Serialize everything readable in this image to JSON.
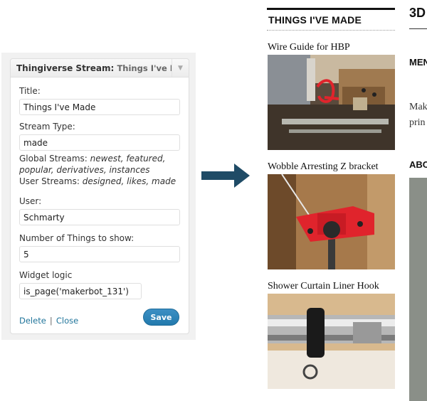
{
  "widget": {
    "title": "Thingiverse Stream:",
    "subtitle": "Things I've Made",
    "fields": {
      "title_label": "Title:",
      "title_value": "Things I've Made",
      "stream_type_label": "Stream Type:",
      "stream_type_value": "made",
      "global_prefix": "Global Streams:",
      "global_line1": "newest, featured,",
      "global_line2": "popular, derivatives, instances",
      "user_prefix": "User Streams:",
      "user_values": "designed, likes, made",
      "user_label": "User:",
      "user_value": "Schmarty",
      "count_label": "Number of Things to show:",
      "count_value": "5",
      "logic_label": "Widget logic",
      "logic_value": "is_page('makerbot_131')"
    },
    "delete_label": "Delete",
    "separator": "|",
    "close_label": "Close",
    "save_label": "Save"
  },
  "sidebar": {
    "heading": "THINGS I'VE MADE",
    "items": [
      {
        "title": "Wire Guide for HBP"
      },
      {
        "title": "Wobble Arresting Z bracket"
      },
      {
        "title": "Shower Curtain Liner Hook"
      }
    ]
  },
  "main_col": {
    "heading": "3D",
    "men_heading": "MEN",
    "para_line1": "Mak",
    "para_line2": "prin",
    "abo_heading": "ABO"
  },
  "colors": {
    "link": "#21759b",
    "save_button": "#2a82b8",
    "arrow": "#1f4b66"
  }
}
